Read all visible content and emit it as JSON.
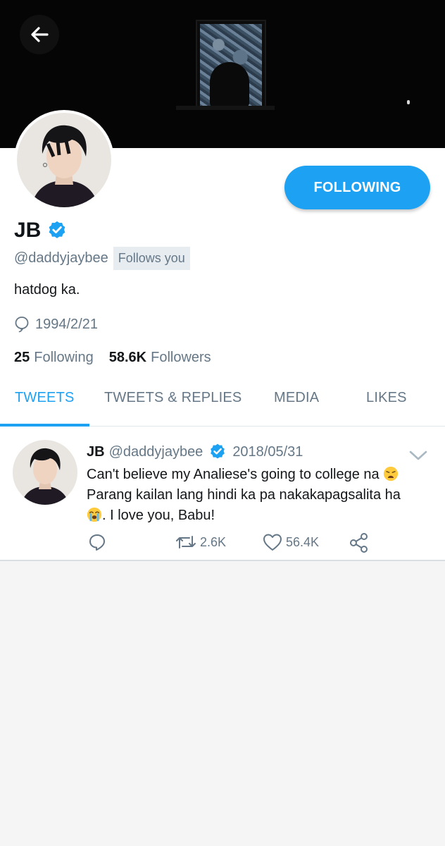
{
  "profile": {
    "name": "JB",
    "handle": "@daddyjaybee",
    "follows_you_badge": "Follows you",
    "bio": "hatdog ka.",
    "birthday": "1994/2/21",
    "following_count": "25",
    "following_label": "Following",
    "followers_count": "58.6K",
    "followers_label": "Followers",
    "follow_button_label": "FOLLOWING",
    "verified": true
  },
  "tabs": [
    {
      "label": "TWEETS",
      "active": true
    },
    {
      "label": "TWEETS & REPLIES",
      "active": false
    },
    {
      "label": "MEDIA",
      "active": false
    },
    {
      "label": "LIKES",
      "active": false
    }
  ],
  "tweet": {
    "name": "JB",
    "handle": "@daddyjaybee",
    "date": "2018/05/31",
    "text_line1": "Can't believe my Analiese's going to college na",
    "text_line2": "Parang kailan lang hindi ka pa nakakapagsalita ha",
    "text_line3": ". I love you, Babu!",
    "emoji1": "weary-face",
    "emoji2": "loudly-crying-face",
    "retweets": "2.6K",
    "likes": "56.4K"
  },
  "colors": {
    "accent": "#1da1f2",
    "secondary_text": "#657786",
    "banner": "#050505"
  },
  "icons": {
    "back": "arrow-left-icon",
    "verified": "verified-badge-icon",
    "birthday": "balloon-icon",
    "caret": "chevron-down-icon",
    "reply": "reply-icon",
    "retweet": "retweet-icon",
    "like": "heart-icon",
    "share": "share-icon"
  }
}
